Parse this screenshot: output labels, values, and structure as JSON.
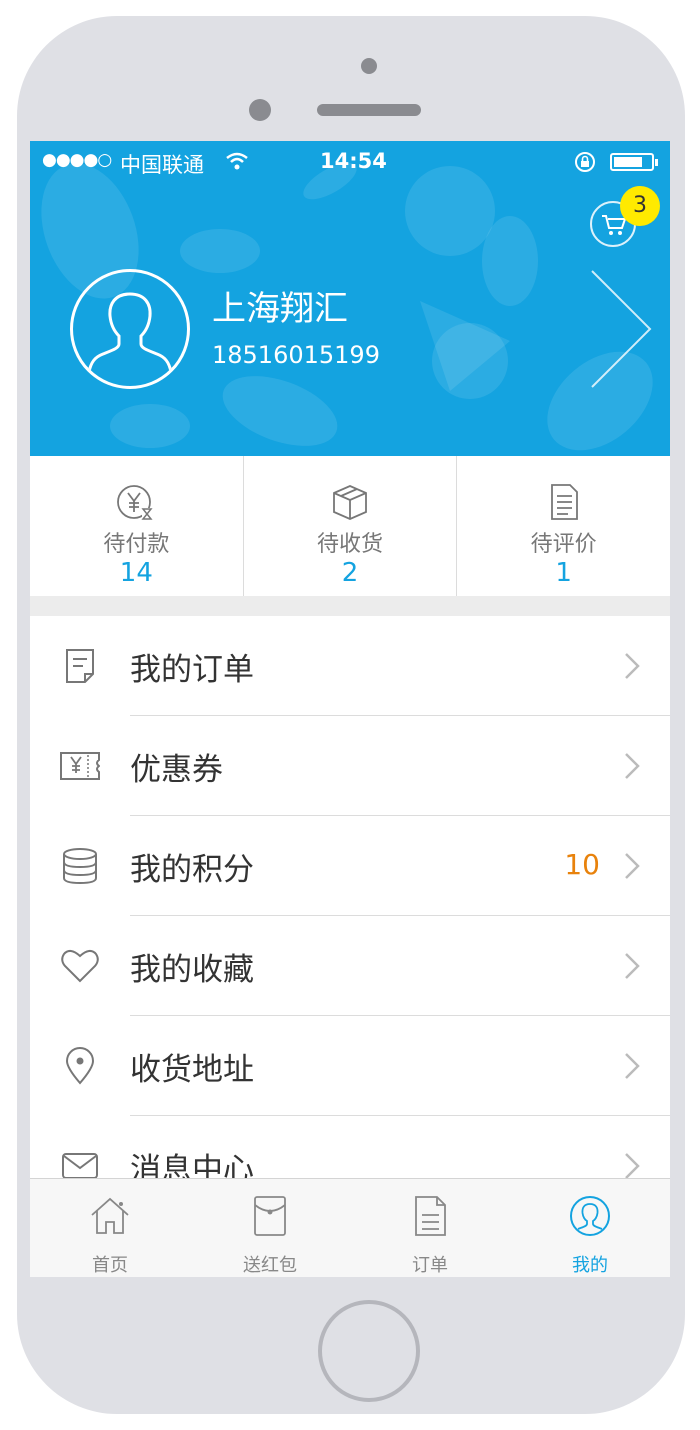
{
  "status_bar": {
    "signal_dots": "●●●●○",
    "carrier": "中国联通",
    "time": "14:54"
  },
  "header": {
    "cart_badge": "3",
    "username": "上海翔汇",
    "phone": "18516015199",
    "bg_color": "#14a3e0"
  },
  "stats": [
    {
      "icon": "yen-hourglass-icon",
      "label": "待付款",
      "value": "14"
    },
    {
      "icon": "package-box-icon",
      "label": "待收货",
      "value": "2"
    },
    {
      "icon": "document-icon",
      "label": "待评价",
      "value": "1"
    }
  ],
  "menu": [
    {
      "icon": "order-note-icon",
      "label": "我的订单",
      "extra": ""
    },
    {
      "icon": "coupon-ticket-icon",
      "label": "优惠券",
      "extra": ""
    },
    {
      "icon": "coins-stack-icon",
      "label": "我的积分",
      "extra": "10"
    },
    {
      "icon": "heart-icon",
      "label": "我的收藏",
      "extra": ""
    },
    {
      "icon": "location-pin-icon",
      "label": "收货地址",
      "extra": ""
    },
    {
      "icon": "mail-envelope-icon",
      "label": "消息中心",
      "extra": ""
    }
  ],
  "tabbar": [
    {
      "icon": "home-icon",
      "label": "首页",
      "active": false
    },
    {
      "icon": "red-envelope-icon",
      "label": "送红包",
      "active": false
    },
    {
      "icon": "order-list-icon",
      "label": "订单",
      "active": false
    },
    {
      "icon": "user-profile-icon",
      "label": "我的",
      "active": true
    }
  ],
  "colors": {
    "accent": "#14a3e0",
    "points_highlight": "#e8820c",
    "badge": "#ffea00"
  }
}
